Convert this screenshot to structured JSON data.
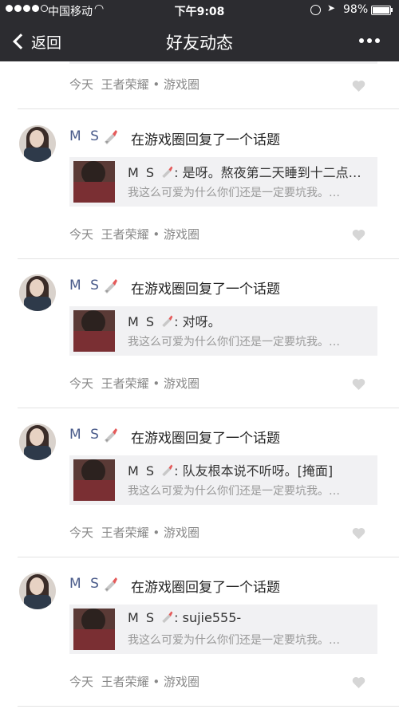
{
  "status_bar": {
    "carrier": "中国移动",
    "time": "下午9:08",
    "battery": "98%",
    "battery_level": 0.98
  },
  "nav": {
    "back_label": "返回",
    "title": "好友动态"
  },
  "first_meta": {
    "time": "今天",
    "game": "王者荣耀",
    "separator": "•",
    "circle": "游戏圈"
  },
  "posts": [
    {
      "name": "M S",
      "action": "在游戏圈回复了一个话题",
      "reply_name": "M S",
      "reply_text": ": 是呀。熬夜第二天睡到十二点…",
      "topic": "我这么可爱为什么你们还是一定要坑我。…",
      "time": "今天",
      "game": "王者荣耀",
      "separator": "•",
      "circle": "游戏圈"
    },
    {
      "name": "M S",
      "action": "在游戏圈回复了一个话题",
      "reply_name": "M S",
      "reply_text": ": 对呀。",
      "topic": "我这么可爱为什么你们还是一定要坑我。…",
      "time": "今天",
      "game": "王者荣耀",
      "separator": "•",
      "circle": "游戏圈"
    },
    {
      "name": "M S",
      "action": "在游戏圈回复了一个话题",
      "reply_name": "M S",
      "reply_text": ": 队友根本说不听呀。[掩面]",
      "topic": "我这么可爱为什么你们还是一定要坑我。…",
      "time": "今天",
      "game": "王者荣耀",
      "separator": "•",
      "circle": "游戏圈"
    },
    {
      "name": "M S",
      "action": "在游戏圈回复了一个话题",
      "reply_name": "M S",
      "reply_text": ": sujie555-",
      "topic": "我这么可爱为什么你们还是一定要坑我。…",
      "time": "今天",
      "game": "王者荣耀",
      "separator": "•",
      "circle": "游戏圈"
    }
  ],
  "colors": {
    "nav_bg": "#2c2c30",
    "name_blue": "#4a5b8a",
    "meta_gray": "#888888",
    "quote_bg": "#f1f1f3"
  },
  "icons": [
    "signal-icon",
    "wifi-icon",
    "lock-rotation-icon",
    "location-icon",
    "battery-icon",
    "back-chevron-icon",
    "more-icon",
    "badge-icon",
    "heart-icon"
  ]
}
